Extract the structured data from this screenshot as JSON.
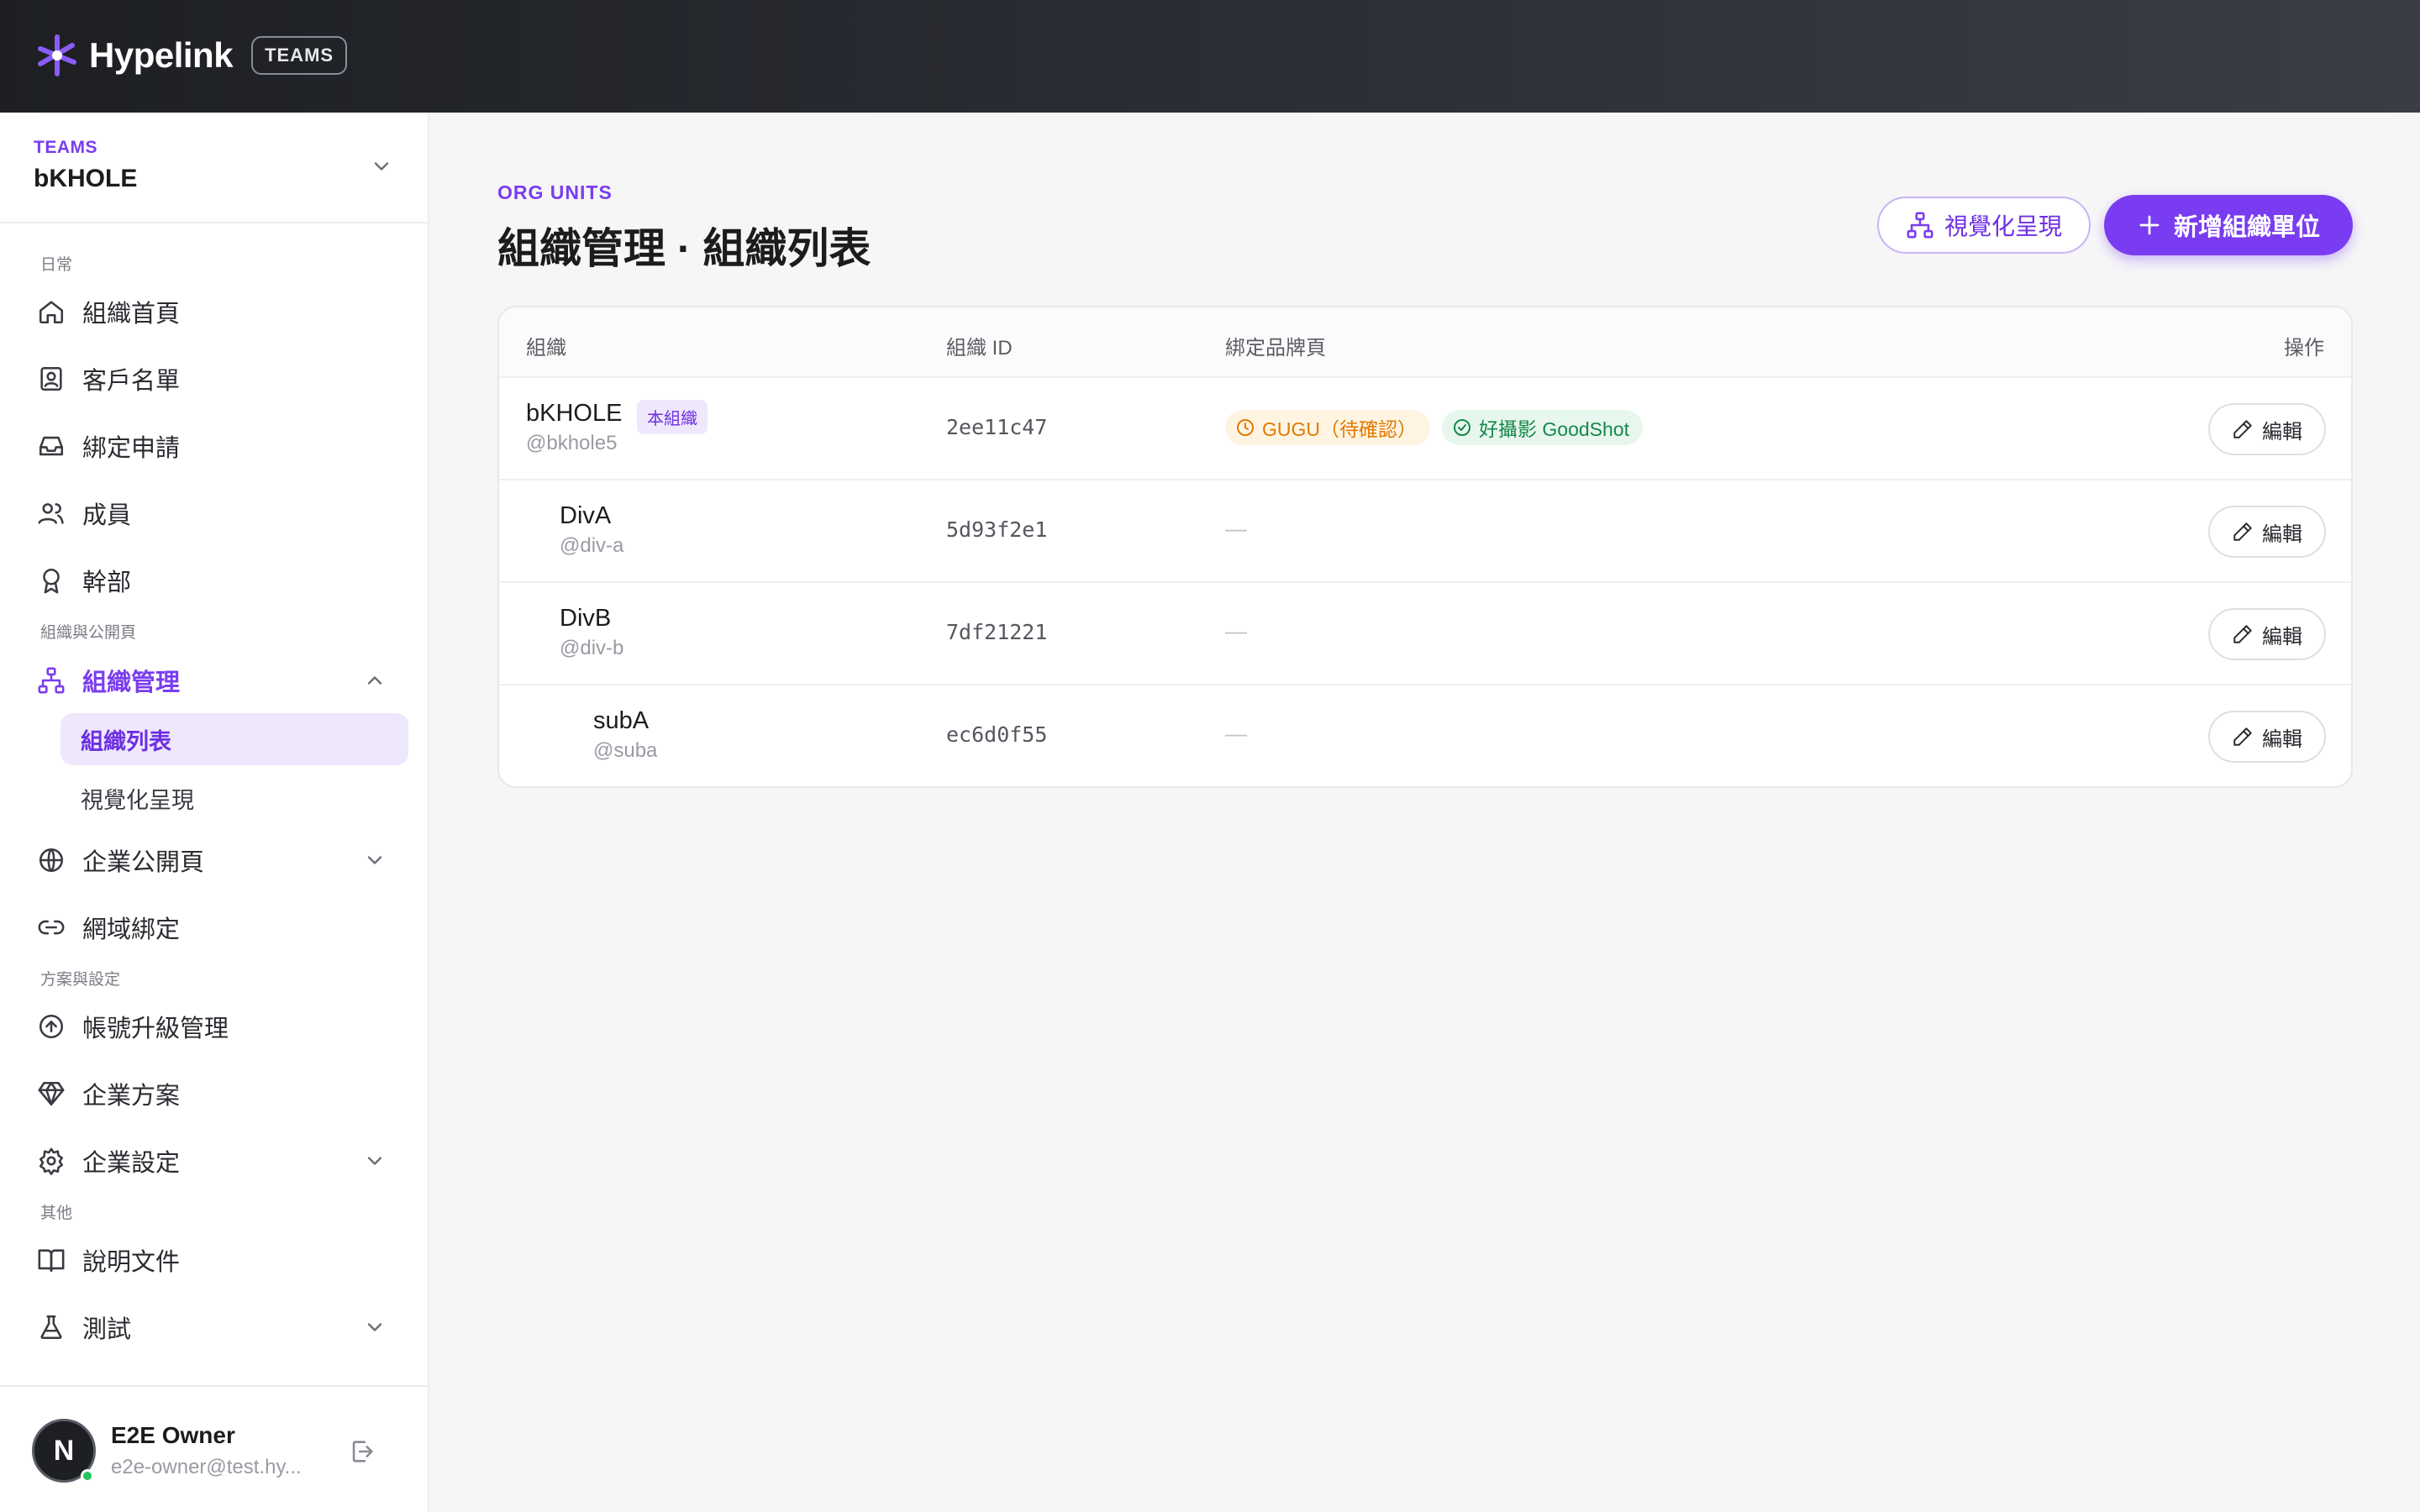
{
  "brand": {
    "name": "Hypelink",
    "badge": "TEAMS",
    "accent": "#7a3cf0"
  },
  "team": {
    "eyebrow": "TEAMS",
    "name": "bKHOLE"
  },
  "sidebar": {
    "sections": [
      "日常",
      "組織與公開頁",
      "方案與設定",
      "其他"
    ],
    "items": [
      {
        "label": "組織首頁",
        "icon": "home-icon"
      },
      {
        "label": "客戶名單",
        "icon": "contact-icon"
      },
      {
        "label": "綁定申請",
        "icon": "inbox-icon"
      },
      {
        "label": "成員",
        "icon": "users-icon"
      },
      {
        "label": "幹部",
        "icon": "award-icon"
      },
      {
        "label": "組織管理",
        "icon": "org-tree-icon"
      },
      {
        "label": "企業公開頁",
        "icon": "globe-icon"
      },
      {
        "label": "網域綁定",
        "icon": "link-icon"
      },
      {
        "label": "帳號升級管理",
        "icon": "arrow-up-circle-icon"
      },
      {
        "label": "企業方案",
        "icon": "gem-icon"
      },
      {
        "label": "企業設定",
        "icon": "gear-icon"
      },
      {
        "label": "說明文件",
        "icon": "book-icon"
      },
      {
        "label": "測試",
        "icon": "flask-icon"
      }
    ],
    "sub_items": [
      {
        "label": "組織列表"
      },
      {
        "label": "視覺化呈現"
      }
    ]
  },
  "user": {
    "initial": "N",
    "name": "E2E Owner",
    "email": "e2e-owner@test.hy..."
  },
  "main": {
    "eyebrow": "ORG UNITS",
    "title": "組織管理 · 組織列表",
    "visualize_button": "視覺化呈現",
    "add_button": "新增組織單位",
    "table": {
      "headers": [
        "組織",
        "組織 ID",
        "綁定品牌頁",
        "操作"
      ],
      "self_badge": "本組織",
      "empty_dash": "—",
      "edit_label": "編輯",
      "rows": [
        {
          "name": "bKHOLE",
          "slug": "@bkhole5",
          "id": "2ee11c47",
          "pending_brand": "GUGU（待確認）",
          "bound_brand": "好攝影 GoodShot"
        },
        {
          "name": "DivA",
          "slug": "@div-a",
          "id": "5d93f2e1"
        },
        {
          "name": "DivB",
          "slug": "@div-b",
          "id": "7df21221"
        },
        {
          "name": "subA",
          "slug": "@suba",
          "id": "ec6d0f55"
        }
      ]
    }
  }
}
